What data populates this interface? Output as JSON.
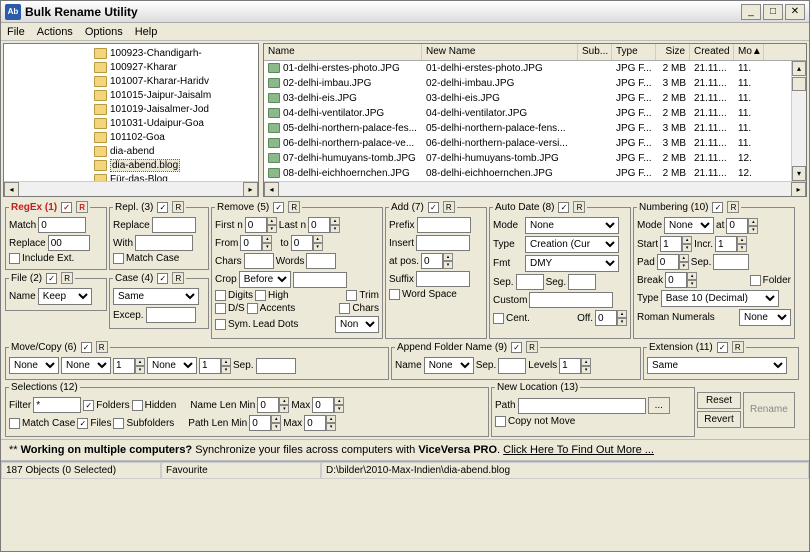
{
  "title": "Bulk Rename Utility",
  "menu": {
    "file": "File",
    "actions": "Actions",
    "options": "Options",
    "help": "Help"
  },
  "tree": {
    "items": [
      {
        "label": "100923-Chandigarh-"
      },
      {
        "label": "100927-Kharar"
      },
      {
        "label": "101007-Kharar-Haridv"
      },
      {
        "label": "101015-Jaipur-Jaisalm"
      },
      {
        "label": "101019-Jaisalmer-Jod"
      },
      {
        "label": "101031-Udaipur-Goa"
      },
      {
        "label": "101102-Goa"
      },
      {
        "label": "dia-abend"
      },
      {
        "label": "dia-abend.blog",
        "selected": true
      },
      {
        "label": "Für-das-Blog"
      }
    ]
  },
  "list": {
    "cols": {
      "name": "Name",
      "newname": "New Name",
      "sub": "Sub...",
      "type": "Type",
      "size": "Size",
      "created": "Created",
      "mod": "Mo"
    },
    "rows": [
      {
        "name": "01-delhi-erstes-photo.JPG",
        "newname": "01-delhi-erstes-photo.JPG",
        "type": "JPG F...",
        "size": "2 MB",
        "created": "21.11...",
        "mod": "11."
      },
      {
        "name": "02-delhi-imbau.JPG",
        "newname": "02-delhi-imbau.JPG",
        "type": "JPG F...",
        "size": "3 MB",
        "created": "21.11...",
        "mod": "11."
      },
      {
        "name": "03-delhi-eis.JPG",
        "newname": "03-delhi-eis.JPG",
        "type": "JPG F...",
        "size": "2 MB",
        "created": "21.11...",
        "mod": "11."
      },
      {
        "name": "04-delhi-ventilator.JPG",
        "newname": "04-delhi-ventilator.JPG",
        "type": "JPG F...",
        "size": "2 MB",
        "created": "21.11...",
        "mod": "11."
      },
      {
        "name": "05-delhi-northern-palace-fes...",
        "newname": "05-delhi-northern-palace-fens...",
        "type": "JPG F...",
        "size": "3 MB",
        "created": "21.11...",
        "mod": "11."
      },
      {
        "name": "06-delhi-northern-palace-ve...",
        "newname": "06-delhi-northern-palace-versi...",
        "type": "JPG F...",
        "size": "3 MB",
        "created": "21.11...",
        "mod": "11."
      },
      {
        "name": "07-delhi-humuyans-tomb.JPG",
        "newname": "07-delhi-humuyans-tomb.JPG",
        "type": "JPG F...",
        "size": "2 MB",
        "created": "21.11...",
        "mod": "12."
      },
      {
        "name": "08-delhi-eichhoernchen.JPG",
        "newname": "08-delhi-eichhoernchen.JPG",
        "type": "JPG F...",
        "size": "2 MB",
        "created": "21.11...",
        "mod": "12."
      }
    ]
  },
  "grp": {
    "regex": {
      "title": "RegEx (1)",
      "match": "Match",
      "replace": "Replace",
      "match_v": "0",
      "replace_v": "00",
      "inc": "Include Ext.",
      "r": "R"
    },
    "file": {
      "title": "File (2)",
      "name": "Name",
      "sel": "Keep",
      "r": "R"
    },
    "repl": {
      "title": "Repl. (3)",
      "replace": "Replace",
      "with": "With",
      "matchcase": "Match Case",
      "r": "R"
    },
    "case": {
      "title": "Case (4)",
      "sel": "Same",
      "excep": "Excep.",
      "r": "R"
    },
    "remove": {
      "title": "Remove (5)",
      "firstn": "First n",
      "lastn": "Last n",
      "from": "From",
      "to": "to",
      "chars": "Chars",
      "words": "Words",
      "crop": "Crop",
      "crop_sel": "Before",
      "digits": "Digits",
      "high": "High",
      "ds": "D/S",
      "accents": "Accents",
      "sym": "Sym.",
      "leaddots": "Lead Dots",
      "leaddots_sel": "Non",
      "trim": "Trim",
      "chars2": "Chars",
      "firstn_v": "0",
      "lastn_v": "0",
      "from_v": "0",
      "to_v": "0",
      "r": "R"
    },
    "move": {
      "title": "Move/Copy (6)",
      "copy": "None",
      "none1": "None",
      "n1": "1",
      "none2": "None",
      "n2": "1",
      "sep": "Sep.",
      "r": "R"
    },
    "add": {
      "title": "Add (7)",
      "prefix": "Prefix",
      "insert": "Insert",
      "atpos": "at pos.",
      "suffix": "Suffix",
      "wordspace": "Word Space",
      "atpos_v": "0",
      "r": "R"
    },
    "autodate": {
      "title": "Auto Date (8)",
      "mode": "Mode",
      "mode_sel": "None",
      "type": "Type",
      "type_sel": "Creation (Cur",
      "fmt": "Fmt",
      "fmt_sel": "DMY",
      "sep": "Sep.",
      "seg": "Seg.",
      "custom": "Custom",
      "cent": "Cent.",
      "off": "Off.",
      "off_v": "0",
      "r": "R"
    },
    "appfolder": {
      "title": "Append Folder Name (9)",
      "name": "Name",
      "name_sel": "None",
      "sep": "Sep.",
      "levels": "Levels",
      "levels_v": "1",
      "r": "R"
    },
    "numbering": {
      "title": "Numbering (10)",
      "mode": "Mode",
      "mode_sel": "None",
      "at": "at",
      "at_v": "0",
      "start": "Start",
      "start_v": "1",
      "incr": "Incr.",
      "incr_v": "1",
      "pad": "Pad",
      "pad_v": "0",
      "sep": "Sep.",
      "break": "Break",
      "break_v": "0",
      "folder": "Folder",
      "type": "Type",
      "type_sel": "Base 10 (Decimal)",
      "roman": "Roman Numerals",
      "roman_sel": "None",
      "r": "R"
    },
    "extension": {
      "title": "Extension (11)",
      "sel": "Same",
      "r": "R"
    },
    "selections": {
      "title": "Selections (12)",
      "filter": "Filter",
      "filter_v": "*",
      "folders": "Folders",
      "hidden": "Hidden",
      "matchcase": "Match Case",
      "files": "Files",
      "subfolders": "Subfolders",
      "namelen": "Name Len Min",
      "pathlen": "Path Len Min",
      "max": "Max",
      "nm_v": "0",
      "pm_v": "0",
      "nmax_v": "0",
      "pmax_v": "0"
    },
    "newloc": {
      "title": "New Location (13)",
      "path": "Path",
      "copynot": "Copy not Move",
      "browse": "..."
    },
    "reset": "Reset",
    "revert": "Revert",
    "rename": "Rename"
  },
  "promo": {
    "prefix": "** ",
    "bold": "Working on multiple computers?",
    "mid": " Synchronize your files across computers with ",
    "vv": "ViceVersa PRO",
    "suffix": ". ",
    "link": "Click Here To Find Out More ..."
  },
  "status": {
    "objects": "187 Objects (0 Selected)",
    "fav": "Favourite",
    "path": "D:\\bilder\\2010-Max-Indien\\dia-abend.blog"
  }
}
